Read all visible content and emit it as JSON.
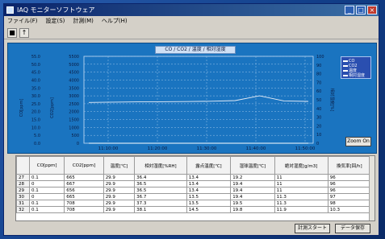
{
  "window": {
    "title": "IAQ モニターソフトウェア"
  },
  "menu": [
    "ファイル(F)",
    "設定(S)",
    "計測(M)",
    "ヘルプ(H)"
  ],
  "toolbar": {
    "btn1": "■",
    "btn2": "↑"
  },
  "chart": {
    "title": "CO / CO2 / 温度 / 相対湿度",
    "legend": [
      "CO",
      "CO2",
      "温度",
      "相対湿度"
    ],
    "zoom_label": "Zoom On",
    "left_axis1_label": "CO[ppm]",
    "left_axis2_label": "CO2[ppm]",
    "right_axis_label": "相対湿度[%]",
    "axis1_ticks": [
      "55.0",
      "50.0",
      "45.0",
      "40.0",
      "35.0",
      "30.0",
      "25.0",
      "20.0",
      "15.0",
      "10.0",
      "5.0",
      "0.0"
    ],
    "axis2_ticks": [
      "5500",
      "5000",
      "4500",
      "4000",
      "3500",
      "3000",
      "2500",
      "2000",
      "1500",
      "1000",
      "500",
      "0"
    ],
    "right_ticks": [
      "100",
      "90",
      "80",
      "70",
      "60",
      "50",
      "40",
      "30",
      "20",
      "10",
      "0"
    ],
    "x_ticks": [
      "11:10:00",
      "11:20:00",
      "11:30:00",
      "11:40:00",
      "11:50:00"
    ]
  },
  "chart_data": {
    "type": "line",
    "x": [
      "11:10:00",
      "11:15:00",
      "11:20:00",
      "11:25:00",
      "11:30:00",
      "11:35:00",
      "11:40:00",
      "11:45:00",
      "11:50:00",
      "11:55:00"
    ],
    "ylim": [
      0,
      5500
    ],
    "series": [
      {
        "name": "CO2",
        "values": [
          2580,
          2600,
          2620,
          2630,
          2640,
          2660,
          2700,
          3000,
          2680,
          2650
        ],
        "color": "#e8eef8"
      },
      {
        "name": "CO",
        "values": [
          0,
          0,
          0,
          0,
          0,
          0,
          0,
          0,
          0,
          0
        ],
        "color": "#ffffff"
      }
    ]
  },
  "table": {
    "headers": [
      "",
      "CO[ppm]",
      "CO2[ppm]",
      "温度[℃]",
      "相対湿度[%RH]",
      "露点温度[℃]",
      "湿球温度[℃]",
      "絶対湿度[g/m3]",
      "換気率[回/h]"
    ],
    "rows": [
      [
        "27",
        "0.1",
        "665",
        "29.9",
        "36.4",
        "13.4",
        "19.2",
        "11",
        "96"
      ],
      [
        "28",
        "0",
        "667",
        "29.9",
        "36.5",
        "13.4",
        "19.4",
        "11",
        "96"
      ],
      [
        "29",
        "0.1",
        "656",
        "29.9",
        "36.5",
        "13.4",
        "19.4",
        "11",
        "96"
      ],
      [
        "30",
        "0",
        "665",
        "29.9",
        "36.7",
        "13.5",
        "19.4",
        "11.3",
        "97"
      ],
      [
        "31",
        "0.1",
        "708",
        "29.9",
        "37.3",
        "13.5",
        "19.5",
        "11.3",
        "98"
      ],
      [
        "32",
        "0.1",
        "708",
        "29.9",
        "38.1",
        "14.5",
        "19.8",
        "11.9",
        "10.3"
      ]
    ]
  },
  "buttons": {
    "start": "計測スタート",
    "save": "データ保存"
  }
}
